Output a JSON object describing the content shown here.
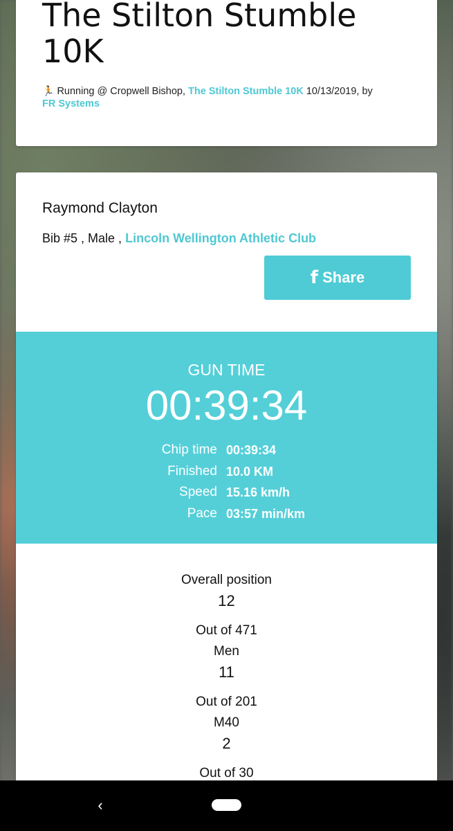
{
  "header": {
    "title": "The Stilton Stumble 10K",
    "activity": "Running @ Cropwell Bishop,",
    "event_link": "The Stilton Stumble 10K",
    "date": "10/13/2019, by",
    "organizer_link": "FR Systems"
  },
  "athlete": {
    "name": "Raymond Clayton",
    "bib_gender": "Bib #5 , Male ,",
    "club_link": "Lincoln Wellington Athletic Club"
  },
  "share": {
    "label": "Share",
    "icon": "facebook-icon"
  },
  "result": {
    "gun_label": "GUN TIME",
    "gun_time": "00:39:34",
    "stats": [
      {
        "label": "Chip time",
        "value": "00:39:34"
      },
      {
        "label": "Finished",
        "value": "10.0 KM"
      },
      {
        "label": "Speed",
        "value": "15.16 km/h"
      },
      {
        "label": "Pace",
        "value": "03:57 min/km"
      }
    ]
  },
  "positions": [
    {
      "label": "Overall position",
      "value": "12",
      "out_of": "Out of 471"
    },
    {
      "label": "Men",
      "value": "11",
      "out_of": "Out of 201"
    },
    {
      "label": "M40",
      "value": "2",
      "out_of": "Out of 30"
    }
  ],
  "colors": {
    "accent": "#54cfd8",
    "link": "#4ec8d3"
  }
}
